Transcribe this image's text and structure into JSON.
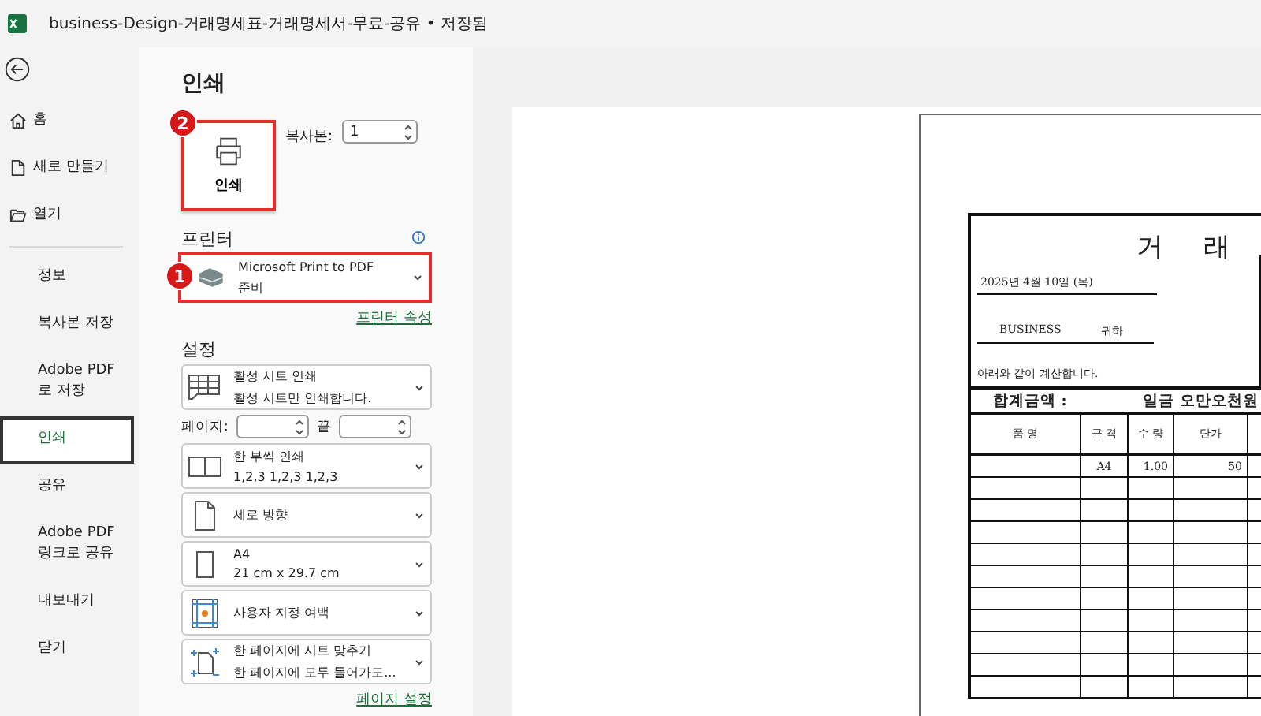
{
  "window": {
    "title": "business-Design-거래명세표-거래명세서-무료-공유 • 저장됨"
  },
  "sidebar": {
    "items": [
      {
        "label": "홈",
        "kind": "home",
        "selected": false
      },
      {
        "label": "새로 만들기",
        "kind": "new",
        "selected": false
      },
      {
        "label": "열기",
        "kind": "open",
        "selected": false
      },
      {
        "label": "정보",
        "kind": "text",
        "selected": false
      },
      {
        "label": "복사본 저장",
        "kind": "text",
        "selected": false
      },
      {
        "label": "Adobe PDF로 저장",
        "kind": "text",
        "selected": false
      },
      {
        "label": "인쇄",
        "kind": "text",
        "selected": true
      },
      {
        "label": "공유",
        "kind": "text",
        "selected": false
      },
      {
        "label": "Adobe PDF 링크로 공유",
        "kind": "text",
        "selected": false
      },
      {
        "label": "내보내기",
        "kind": "text",
        "selected": false
      },
      {
        "label": "닫기",
        "kind": "text",
        "selected": false
      }
    ]
  },
  "print": {
    "heading": "인쇄",
    "button": "인쇄",
    "button_badge": "2",
    "copies_label": "복사본:",
    "copies": "1",
    "printer_heading": "프린터",
    "printer_name": "Microsoft Print to PDF",
    "printer_status": "준비",
    "printer_badge": "1",
    "printer_properties": "프린터 속성",
    "settings_heading": "설정",
    "settings": [
      {
        "kind": "sheet",
        "line1": "활성 시트 인쇄",
        "line2": "활성 시트만 인쇄합니다."
      },
      {
        "kind": "pages",
        "label": "페이지:",
        "to_label": "끝"
      },
      {
        "kind": "collate",
        "line1": "한 부씩 인쇄",
        "line2": "1,2,3    1,2,3    1,2,3"
      },
      {
        "kind": "orientation",
        "line1": "세로 방향"
      },
      {
        "kind": "paper",
        "line1": "A4",
        "line2": "21 cm x 29.7 cm"
      },
      {
        "kind": "margins",
        "line1": "사용자 지정 여백"
      },
      {
        "kind": "scaling",
        "line1": "한 페이지에 시트 맞추기",
        "line2": "한 페이지에 모두 들어가도..."
      }
    ],
    "page_setup": "페이지 설정"
  },
  "preview": {
    "title": "거 래",
    "date": "2025년 4월 10일 (목)",
    "recipient": "BUSINESS",
    "honorific": "귀하",
    "note": "아래와 같이 계산합니다.",
    "total_label": "합계금액 :",
    "total_value": "일금 오만오천원",
    "columns": [
      "품 명",
      "규 격",
      "수 량",
      "단가"
    ],
    "rows": [
      {
        "cells": [
          "",
          "A4",
          "1.00",
          "50"
        ]
      }
    ]
  }
}
